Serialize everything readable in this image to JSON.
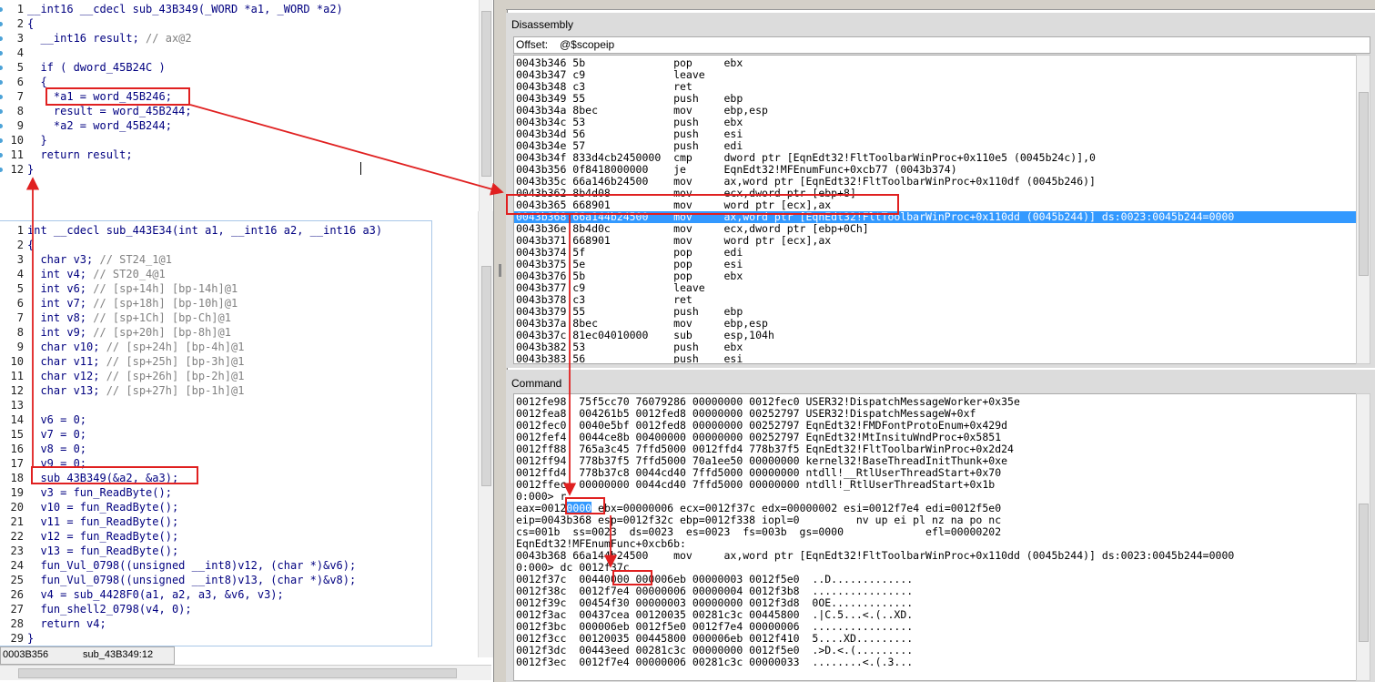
{
  "pseudocode_top": {
    "lines": [
      {
        "n": "1",
        "text": "__int16 __cdecl sub_43B349(_WORD *a1, _WORD *a2)"
      },
      {
        "n": "2",
        "text": "{"
      },
      {
        "n": "3",
        "text": "  __int16 result; // ax@2"
      },
      {
        "n": "4",
        "text": ""
      },
      {
        "n": "5",
        "text": "  if ( dword_45B24C )"
      },
      {
        "n": "6",
        "text": "  {"
      },
      {
        "n": "7",
        "text": "    *a1 = word_45B246;"
      },
      {
        "n": "8",
        "text": "    result = word_45B244;"
      },
      {
        "n": "9",
        "text": "    *a2 = word_45B244;"
      },
      {
        "n": "10",
        "text": "  }"
      },
      {
        "n": "11",
        "text": "  return result;"
      },
      {
        "n": "12",
        "text": "}"
      }
    ]
  },
  "pseudocode_bottom": {
    "lines": [
      {
        "n": "1",
        "text": "int __cdecl sub_443E34(int a1, __int16 a2, __int16 a3)"
      },
      {
        "n": "2",
        "text": "{"
      },
      {
        "n": "3",
        "text": "  char v3; // ST24_1@1"
      },
      {
        "n": "4",
        "text": "  int v4; // ST20_4@1"
      },
      {
        "n": "5",
        "text": "  int v6; // [sp+14h] [bp-14h]@1"
      },
      {
        "n": "6",
        "text": "  int v7; // [sp+18h] [bp-10h]@1"
      },
      {
        "n": "7",
        "text": "  int v8; // [sp+1Ch] [bp-Ch]@1"
      },
      {
        "n": "8",
        "text": "  int v9; // [sp+20h] [bp-8h]@1"
      },
      {
        "n": "9",
        "text": "  char v10; // [sp+24h] [bp-4h]@1"
      },
      {
        "n": "10",
        "text": "  char v11; // [sp+25h] [bp-3h]@1"
      },
      {
        "n": "11",
        "text": "  char v12; // [sp+26h] [bp-2h]@1"
      },
      {
        "n": "12",
        "text": "  char v13; // [sp+27h] [bp-1h]@1"
      },
      {
        "n": "13",
        "text": ""
      },
      {
        "n": "14",
        "text": "  v6 = 0;"
      },
      {
        "n": "15",
        "text": "  v7 = 0;"
      },
      {
        "n": "16",
        "text": "  v8 = 0;"
      },
      {
        "n": "17",
        "text": "  v9 = 0;"
      },
      {
        "n": "18",
        "text": "  sub_43B349(&a2, &a3);"
      },
      {
        "n": "19",
        "text": "  v3 = fun_ReadByte();"
      },
      {
        "n": "20",
        "text": "  v10 = fun_ReadByte();"
      },
      {
        "n": "21",
        "text": "  v11 = fun_ReadByte();"
      },
      {
        "n": "22",
        "text": "  v12 = fun_ReadByte();"
      },
      {
        "n": "23",
        "text": "  v13 = fun_ReadByte();"
      },
      {
        "n": "24",
        "text": "  fun_Vul_0798((unsigned __int8)v12, (char *)&v6);"
      },
      {
        "n": "25",
        "text": "  fun_Vul_0798((unsigned __int8)v13, (char *)&v8);"
      },
      {
        "n": "26",
        "text": "  v4 = sub_4428F0(a1, a2, a3, &v6, v3);"
      },
      {
        "n": "27",
        "text": "  fun_shell2_0798(v4, 0);"
      },
      {
        "n": "28",
        "text": "  return v4;"
      },
      {
        "n": "29",
        "text": "}"
      }
    ]
  },
  "status": {
    "address": "0003B356",
    "location": "sub_43B349:12"
  },
  "disassembly": {
    "title": "Disassembly",
    "offset_label": "Offset:",
    "offset_value": "@$scopeip",
    "lines": [
      "0043b346 5b              pop     ebx",
      "0043b347 c9              leave",
      "0043b348 c3              ret",
      "0043b349 55              push    ebp",
      "0043b34a 8bec            mov     ebp,esp",
      "0043b34c 53              push    ebx",
      "0043b34d 56              push    esi",
      "0043b34e 57              push    edi",
      "0043b34f 833d4cb2450000  cmp     dword ptr [EqnEdt32!FltToolbarWinProc+0x110e5 (0045b24c)],0",
      "0043b356 0f8418000000    je      EqnEdt32!MFEnumFunc+0xcb77 (0043b374)",
      "0043b35c 66a146b24500    mov     ax,word ptr [EqnEdt32!FltToolbarWinProc+0x110df (0045b246)]",
      "0043b362 8b4d08          mov     ecx,dword ptr [ebp+8]",
      "0043b365 668901          mov     word ptr [ecx],ax",
      "0043b368 66a144b24500    mov     ax,word ptr [EqnEdt32!FltToolbarWinProc+0x110dd (0045b244)] ds:0023:0045b244=0000",
      "0043b36e 8b4d0c          mov     ecx,dword ptr [ebp+0Ch]",
      "0043b371 668901          mov     word ptr [ecx],ax",
      "0043b374 5f              pop     edi",
      "0043b375 5e              pop     esi",
      "0043b376 5b              pop     ebx",
      "0043b377 c9              leave",
      "0043b378 c3              ret",
      "0043b379 55              push    ebp",
      "0043b37a 8bec            mov     ebp,esp",
      "0043b37c 81ec04010000    sub     esp,104h",
      "0043b382 53              push    ebx",
      "0043b383 56              push    esi"
    ],
    "highlight_index": 13
  },
  "command": {
    "title": "Command",
    "lines": [
      "0012fe98  75f5cc70 76079286 00000000 0012fec0 USER32!DispatchMessageWorker+0x35e",
      "0012fea8  004261b5 0012fed8 00000000 00252797 USER32!DispatchMessageW+0xf",
      "0012fec0  0040e5bf 0012fed8 00000000 00252797 EqnEdt32!FMDFontProtoEnum+0x429d",
      "0012fef4  0044ce8b 00400000 00000000 00252797 EqnEdt32!MtInsituWndProc+0x5851",
      "0012ff88  765a3c45 7ffd5000 0012ffd4 778b37f5 EqnEdt32!FltToolbarWinProc+0x2d24",
      "0012ff94  778b37f5 7ffd5000 70a1ee50 00000000 kernel32!BaseThreadInitThunk+0xe",
      "0012ffd4  778b37c8 0044cd40 7ffd5000 00000000 ntdll!__RtlUserThreadStart+0x70",
      "0012ffec  00000000 0044cd40 7ffd5000 00000000 ntdll!_RtlUserThreadStart+0x1b",
      "0:000> r",
      "eax=00120000 ebx=00000006 ecx=0012f37c edx=00000002 esi=0012f7e4 edi=0012f5e0",
      "eip=0043b368 esp=0012f32c ebp=0012f338 iopl=0         nv up ei pl nz na po nc",
      "cs=001b  ss=0023  ds=0023  es=0023  fs=003b  gs=0000             efl=00000202",
      "EqnEdt32!MFEnumFunc+0xcb6b:",
      "0043b368 66a144b24500    mov     ax,word ptr [EqnEdt32!FltToolbarWinProc+0x110dd (0045b244)] ds:0023:0045b244=0000",
      "0:000> dc 0012f37c",
      "0012f37c  00440000 000006eb 00000003 0012f5e0  ..D.............",
      "0012f38c  0012f7e4 00000006 00000004 0012f3b8  ................",
      "0012f39c  00454f30 00000003 00000000 0012f3d8  0OE.............",
      "0012f3ac  00437cea 00120035 00281c3c 00445800  .|C.5...<.(..XD.",
      "0012f3bc  000006eb 0012f5e0 0012f7e4 00000006  ................",
      "0012f3cc  00120035 00445800 000006eb 0012f410  5....XD.........",
      "0012f3dc  00443eed 00281c3c 00000000 0012f5e0  .>D.<.(.........",
      "0012f3ec  0012f7e4 00000006 00281c3c 00000033  ........<.(.3..."
    ]
  },
  "colors": {
    "highlight": "#3399ff",
    "annotation": "#e02020",
    "code": "#000080",
    "comment": "#808080"
  }
}
